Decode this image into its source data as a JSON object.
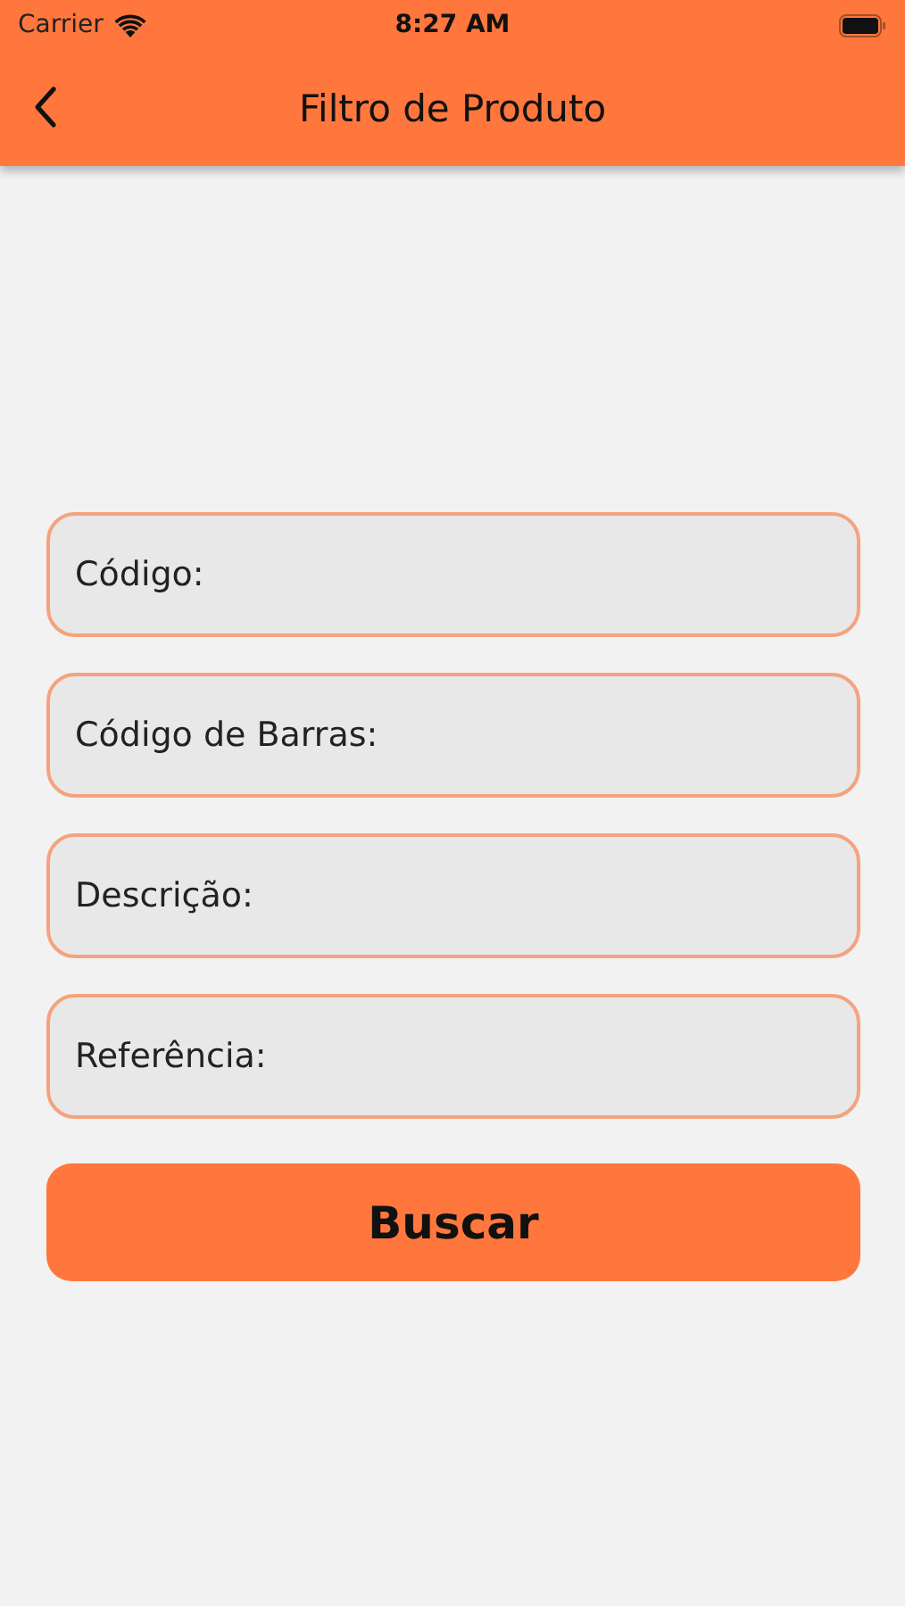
{
  "status_bar": {
    "carrier": "Carrier",
    "time": "8:27 AM"
  },
  "nav_bar": {
    "title": "Filtro de Produto"
  },
  "fields": [
    {
      "placeholder": "Código:"
    },
    {
      "placeholder": "Código de Barras:"
    },
    {
      "placeholder": "Descrição:"
    },
    {
      "placeholder": "Referência:"
    }
  ],
  "search_button": {
    "label": "Buscar"
  }
}
